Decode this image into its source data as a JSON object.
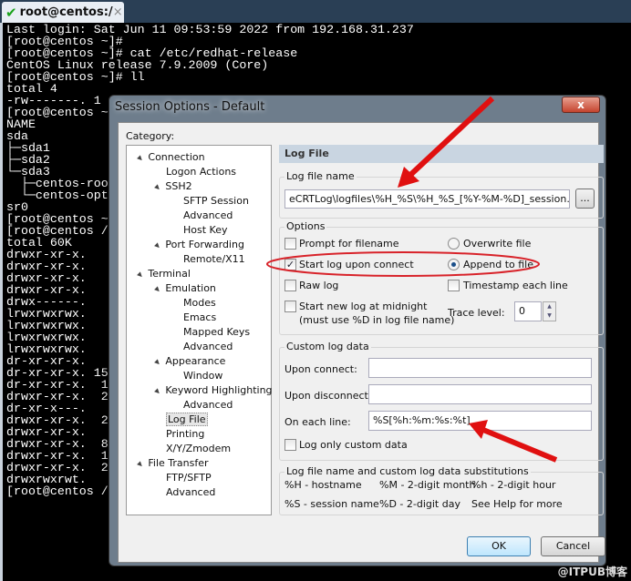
{
  "tab": {
    "title": "root@centos:/",
    "close": "×"
  },
  "terminal_lines": [
    "Last login: Sat Jun 11 09:53:59 2022 from 192.168.31.237",
    "[root@centos ~]#",
    "[root@centos ~]# cat /etc/redhat-release",
    "CentOS Linux release 7.9.2009 (Core)",
    "[root@centos ~]# ll",
    "total 4",
    "-rw-------. 1",
    "[root@centos ~",
    "NAME",
    "sda",
    "├─sda1",
    "├─sda2",
    "└─sda3",
    "  ├─centos-roo",
    "  └─centos-opt",
    "sr0",
    "[root@centos ~",
    "[root@centos /",
    "total 60K",
    "drwxr-xr-x.",
    "drwxr-xr-x.",
    "drwxr-xr-x.",
    "drwxr-xr-x.",
    "drwx------.",
    "lrwxrwxrwx.",
    "lrwxrwxrwx.",
    "lrwxrwxrwx.",
    "lrwxrwxrwx.",
    "dr-xr-xr-x.",
    "dr-xr-xr-x. 15",
    "dr-xr-xr-x.  1",
    "drwxr-xr-x.  2",
    "dr-xr-x---.",
    "drwxr-xr-x.  2",
    "drwxr-xr-x.",
    "drwxr-xr-x.  8",
    "drwxr-xr-x.  1",
    "drwxr-xr-x.  2",
    "drwxrwxrwt.",
    "[root@centos /"
  ],
  "dialog": {
    "title": "Session Options - Default",
    "close": "x",
    "category_label": "Category:",
    "tree": [
      {
        "label": "Connection",
        "level": 0,
        "expanded": true
      },
      {
        "label": "Logon Actions",
        "level": 1
      },
      {
        "label": "SSH2",
        "level": 1,
        "expanded": true
      },
      {
        "label": "SFTP Session",
        "level": 2
      },
      {
        "label": "Advanced",
        "level": 2
      },
      {
        "label": "Host Key",
        "level": 2
      },
      {
        "label": "Port Forwarding",
        "level": 1,
        "expanded": true
      },
      {
        "label": "Remote/X11",
        "level": 2
      },
      {
        "label": "Terminal",
        "level": 0,
        "expanded": true
      },
      {
        "label": "Emulation",
        "level": 1,
        "expanded": true
      },
      {
        "label": "Modes",
        "level": 2
      },
      {
        "label": "Emacs",
        "level": 2
      },
      {
        "label": "Mapped Keys",
        "level": 2
      },
      {
        "label": "Advanced",
        "level": 2
      },
      {
        "label": "Appearance",
        "level": 1,
        "expanded": true
      },
      {
        "label": "Window",
        "level": 2
      },
      {
        "label": "Keyword Highlighting",
        "level": 1,
        "expanded": true
      },
      {
        "label": "Advanced",
        "level": 2
      },
      {
        "label": "Log File",
        "level": 1,
        "selected": true
      },
      {
        "label": "Printing",
        "level": 1
      },
      {
        "label": "X/Y/Zmodem",
        "level": 1
      },
      {
        "label": "File Transfer",
        "level": 0,
        "expanded": true
      },
      {
        "label": "FTP/SFTP",
        "level": 1
      },
      {
        "label": "Advanced",
        "level": 1
      }
    ],
    "header": "Log File",
    "log_file_name": {
      "label": "Log file name",
      "value": "eCRTLog\\logfiles\\%H_%S\\%H_%S_[%Y-%M-%D]_session.log",
      "browse": "..."
    },
    "options": {
      "label": "Options",
      "prompt_for_filename": {
        "label": "Prompt for filename",
        "checked": false
      },
      "start_log_upon_connect": {
        "label": "Start log upon connect",
        "checked": true
      },
      "raw_log": {
        "label": "Raw log",
        "checked": false
      },
      "start_new_log_midnight": {
        "label": "Start new log at midnight",
        "label2": "(must use %D in log file name)",
        "checked": false
      },
      "overwrite_file": {
        "label": "Overwrite file",
        "selected": false
      },
      "append_to_file": {
        "label": "Append to file",
        "selected": true
      },
      "timestamp_each_line": {
        "label": "Timestamp each line",
        "checked": false
      },
      "trace_level": {
        "label": "Trace level:",
        "value": "0"
      }
    },
    "custom": {
      "label": "Custom log data",
      "upon_connect": {
        "label": "Upon connect:",
        "value": ""
      },
      "upon_disconnect": {
        "label": "Upon disconnect:",
        "value": ""
      },
      "on_each_line": {
        "label": "On each line:",
        "value": "%S[%h:%m:%s:%t]"
      },
      "log_only_custom": {
        "label": "Log only custom data",
        "checked": false
      }
    },
    "subs": {
      "label": "Log file name and custom log data substitutions",
      "items": [
        "%H - hostname",
        "%M - 2-digit month",
        "%h - 2-digit hour",
        "%S - session name",
        "%D - 2-digit day",
        "See Help for more"
      ]
    },
    "ok": "OK",
    "cancel": "Cancel"
  },
  "watermark": "@ITPUB博客"
}
